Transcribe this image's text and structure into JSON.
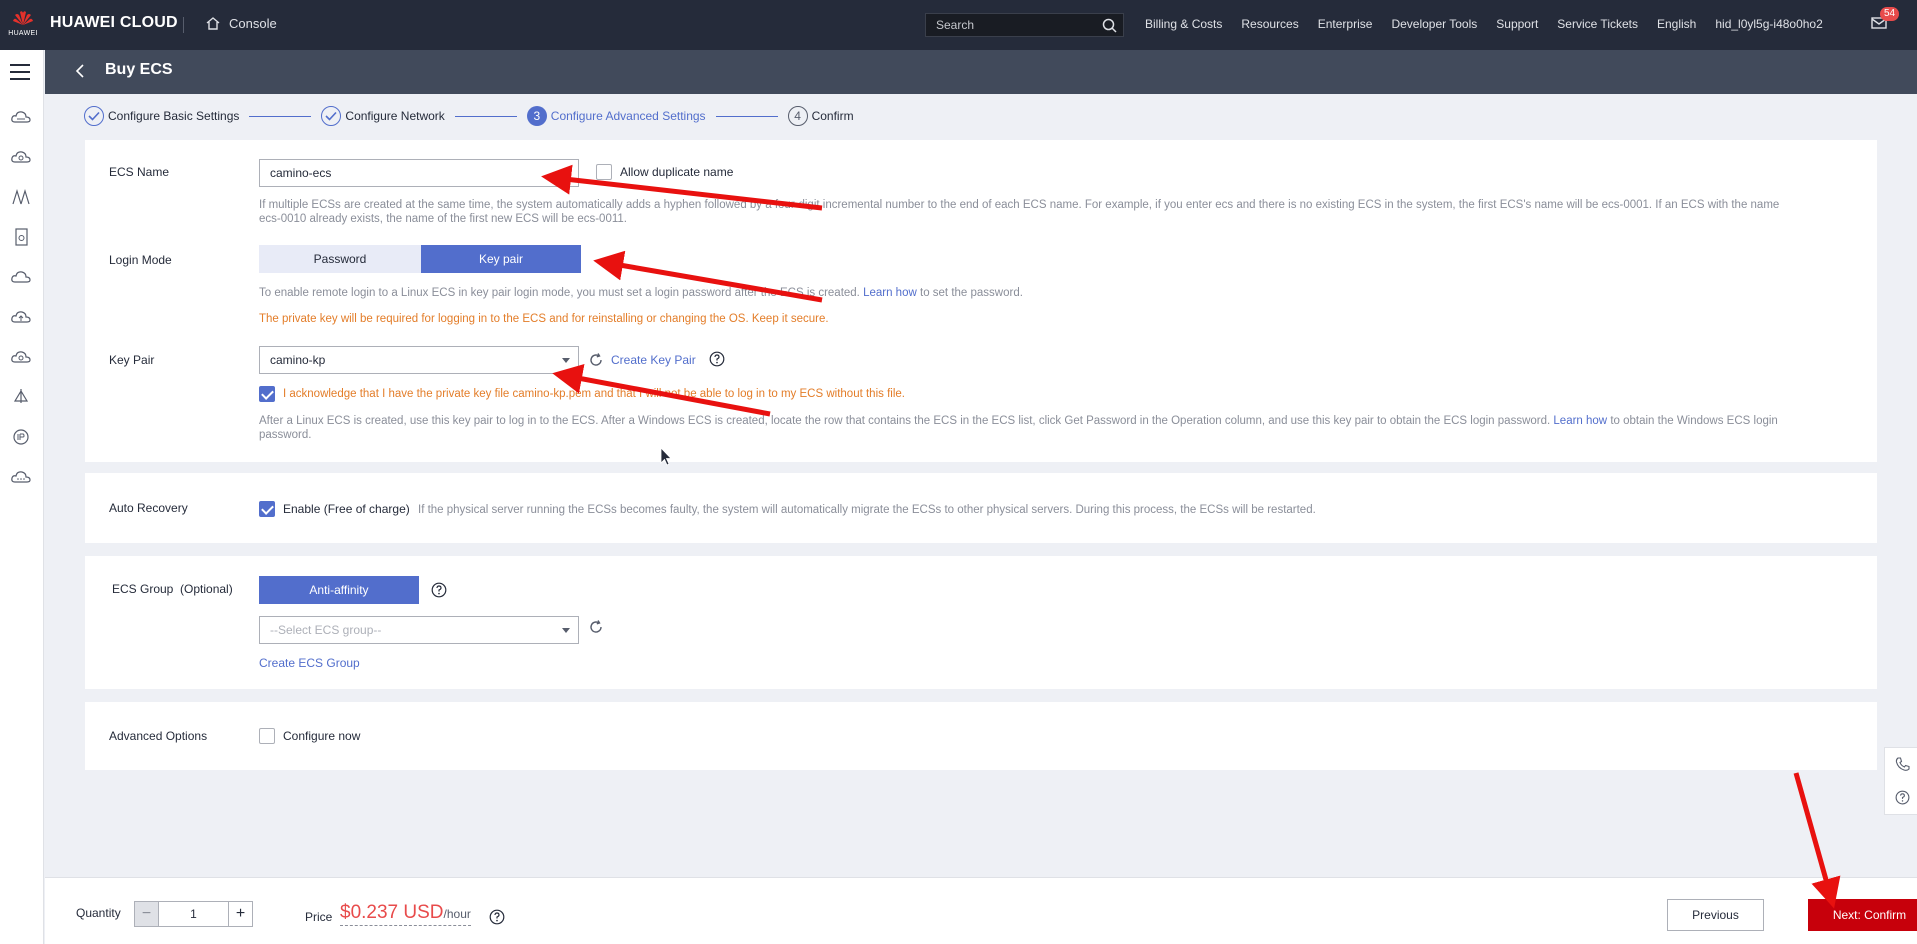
{
  "topbar": {
    "logo_sub": "HUAWEI",
    "brand": "HUAWEI CLOUD",
    "console": "Console",
    "search_placeholder": "Search",
    "nav": [
      "Billing & Costs",
      "Resources",
      "Enterprise",
      "Developer Tools",
      "Support",
      "Service Tickets",
      "English",
      "hid_l0yl5g-i48o0ho2"
    ],
    "mail_badge": "54"
  },
  "header": {
    "title": "Buy ECS"
  },
  "steps": [
    {
      "num": "1",
      "label": "Configure Basic Settings",
      "state": "done"
    },
    {
      "num": "2",
      "label": "Configure Network",
      "state": "done"
    },
    {
      "num": "3",
      "label": "Configure Advanced Settings",
      "state": "active"
    },
    {
      "num": "4",
      "label": "Confirm",
      "state": "todo"
    }
  ],
  "ecs_name": {
    "label": "ECS Name",
    "value": "camino-ecs",
    "allow_duplicate": "Allow duplicate name",
    "hint_line1": "If multiple ECSs are created at the same time, the system automatically adds a hyphen followed by a four-digit incremental number to the end of each ECS name. For example, if you enter ecs and there is no existing ECS in the system, the first ECS's name will be ecs-0001. If an ECS with the name",
    "hint_line2": "ecs-0010 already exists, the name of the first new ECS will be ecs-0011."
  },
  "login_mode": {
    "label": "Login Mode",
    "option_password": "Password",
    "option_keypair": "Key pair",
    "hint_prefix": "To enable remote login to a Linux ECS in key pair login mode, you must set a login password after the ECS is created.",
    "hint_link": "Learn how",
    "hint_suffix": "to set the password.",
    "warning": "The private key will be required for logging in to the ECS and for reinstalling or changing the OS. Keep it secure."
  },
  "key_pair": {
    "label": "Key Pair",
    "value": "camino-kp",
    "create_link": "Create Key Pair",
    "acknowledge": "I acknowledge that I have the private key file camino-kp.pem and that I will not be able to log in to my ECS without this file.",
    "hint_line1_prefix": "After a Linux ECS is created, use this key pair to log in to the ECS. After a Windows ECS is created, locate the row that contains the ECS in the ECS list, click Get Password in the Operation column, and use this key pair to obtain the ECS login password.",
    "hint_link": "Learn how",
    "hint_line1_suffix": "to obtain the Windows ECS login",
    "hint_line2": "password."
  },
  "auto_recovery": {
    "label": "Auto Recovery",
    "enable": "Enable (Free of charge)",
    "hint": "If the physical server running the ECSs becomes faulty, the system will automatically migrate the ECSs to other physical servers. During this process, the ECSs will be restarted."
  },
  "ecs_group": {
    "label": "ECS Group  (Optional)",
    "anti_affinity": "Anti-affinity",
    "select_placeholder": "--Select ECS group--",
    "create_link": "Create ECS Group"
  },
  "advanced": {
    "label": "Advanced Options",
    "configure_now": "Configure now"
  },
  "bottom": {
    "quantity_label": "Quantity",
    "quantity": "1",
    "price_label": "Price",
    "price": "$0.237 USD",
    "price_unit": "/hour",
    "previous": "Previous",
    "next": "Next: Confirm"
  },
  "colors": {
    "topbar": "#252b3a",
    "accent": "#526ecc",
    "warning": "#e37d29",
    "primary_cta": "#c7000b",
    "annotation_arrow": "#e8110f"
  }
}
